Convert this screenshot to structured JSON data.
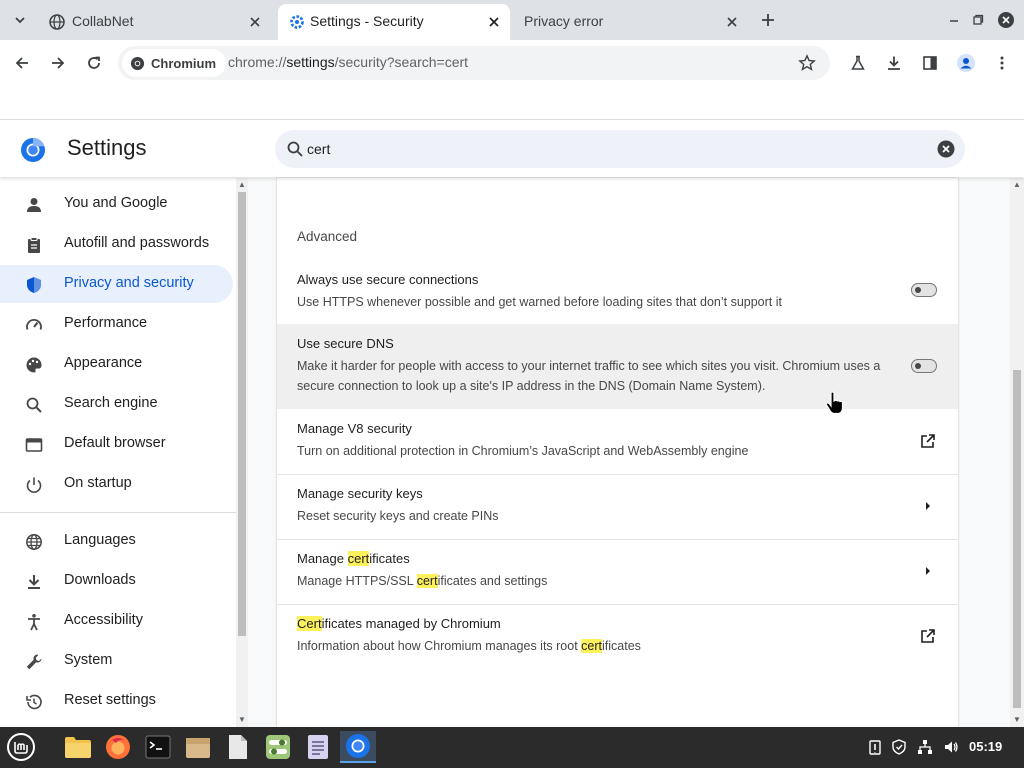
{
  "tabs": [
    {
      "title": "CollabNet",
      "active": false
    },
    {
      "title": "Settings - Security",
      "active": true
    },
    {
      "title": "Privacy error",
      "active": false
    }
  ],
  "toolbar": {
    "site_chip": "Chromium",
    "url_scheme": "chrome://",
    "url_host": "settings",
    "url_path": "/security?search=cert"
  },
  "settings": {
    "title": "Settings",
    "search_value": "cert",
    "search_placeholder": "Search settings"
  },
  "sidebar": {
    "items": [
      {
        "label": "You and Google",
        "icon": "person-icon"
      },
      {
        "label": "Autofill and passwords",
        "icon": "clipboard-icon"
      },
      {
        "label": "Privacy and security",
        "icon": "shield-icon",
        "selected": true
      },
      {
        "label": "Performance",
        "icon": "speedometer-icon"
      },
      {
        "label": "Appearance",
        "icon": "palette-icon"
      },
      {
        "label": "Search engine",
        "icon": "search-icon"
      },
      {
        "label": "Default browser",
        "icon": "browser-window-icon"
      },
      {
        "label": "On startup",
        "icon": "power-icon"
      },
      {
        "label": "Languages",
        "icon": "globe-icon"
      },
      {
        "label": "Downloads",
        "icon": "download-icon"
      },
      {
        "label": "Accessibility",
        "icon": "accessibility-icon"
      },
      {
        "label": "System",
        "icon": "wrench-icon"
      },
      {
        "label": "Reset settings",
        "icon": "reset-history-icon"
      }
    ]
  },
  "main": {
    "section_title": "Advanced",
    "rows": {
      "https": {
        "title": "Always use secure connections",
        "sub": "Use HTTPS whenever possible and get warned before loading sites that don’t support it",
        "enabled": false
      },
      "dns": {
        "title": "Use secure DNS",
        "sub": "Make it harder for people with access to your internet traffic to see which sites you visit. Chromium uses a secure connection to look up a site's IP address in the DNS (Domain Name System).",
        "enabled": false
      },
      "v8": {
        "title": "Manage V8 security",
        "sub": "Turn on additional protection in Chromium’s JavaScript and WebAssembly engine"
      },
      "keys": {
        "title": "Manage security keys",
        "sub": "Reset security keys and create PINs"
      },
      "certs": {
        "title_pre": "Manage ",
        "title_hl": "cert",
        "title_post": "ificates",
        "sub_pre": "Manage HTTPS/SSL ",
        "sub_hl": "cert",
        "sub_post": "ificates and settings"
      },
      "chromium_certs": {
        "title_hl": "Cert",
        "title_post": "ificates managed by Chromium",
        "sub_pre": "Information about how Chromium manages its root ",
        "sub_hl": "cert",
        "sub_post": "ificates"
      }
    }
  },
  "taskbar": {
    "clock": "05:19"
  },
  "colors": {
    "accent": "#0b57d0",
    "highlight": "#fdf15c",
    "tabstrip": "#dee1e6",
    "taskbar": "#2b2b2b"
  }
}
